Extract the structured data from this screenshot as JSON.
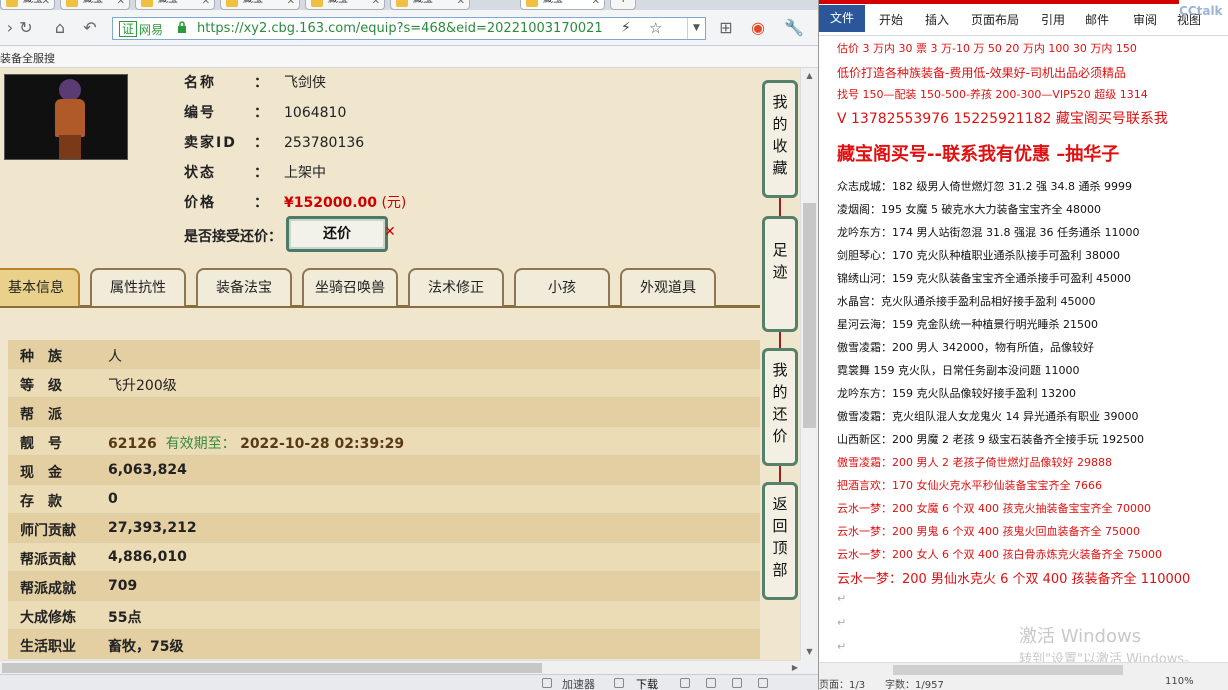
{
  "browser": {
    "tabs": [
      {
        "label": "藏宝"
      },
      {
        "label": "藏宝"
      },
      {
        "label": "藏宝"
      },
      {
        "label": "藏宝"
      },
      {
        "label": "藏宝"
      },
      {
        "label": "藏宝"
      },
      {
        "label": "藏宝"
      }
    ],
    "cert_label": "证",
    "site_label": "网易",
    "url": "https://xy2.cbg.163.com/equip?s=468&eid=20221003170021",
    "favbar_text": "装备全服搜"
  },
  "item_info": {
    "name_label": "名称",
    "name_value": "飞剑侠",
    "number_label": "编号",
    "number_value": "1064810",
    "seller_label": "卖家ID",
    "seller_value": "253780136",
    "status_label": "状态",
    "status_value": "上架中",
    "price_label": "价格",
    "price_value": "¥152000.00",
    "price_unit": "(元)",
    "bargain_label": "是否接受还价：",
    "bargain_button": "还价"
  },
  "tabs": [
    "基本信息",
    "属性抗性",
    "装备法宝",
    "坐骑召唤兽",
    "法术修正",
    "小孩",
    "外观道具"
  ],
  "basic_info": [
    {
      "key": "种族",
      "value": "人"
    },
    {
      "key": "等级",
      "value": "飞升200级"
    },
    {
      "key": "帮派",
      "value": ""
    },
    {
      "key": "靓号",
      "value": "62126",
      "extra_label": "有效期至：",
      "extra_value": "2022-10-28 02:39:29"
    },
    {
      "key": "现金",
      "value": "6,063,824"
    },
    {
      "key": "存款",
      "value": "0"
    },
    {
      "key": "师门贡献",
      "value": "27,393,212"
    },
    {
      "key": "帮派贡献",
      "value": "4,886,010"
    },
    {
      "key": "帮派成就",
      "value": "709"
    },
    {
      "key": "大成修炼",
      "value": "55点"
    },
    {
      "key": "生活职业",
      "value": "畜牧，75级"
    }
  ],
  "side_buttons": [
    {
      "label": "我的收藏"
    },
    {
      "label": "足迹"
    },
    {
      "label": "我的还价"
    },
    {
      "label": "返回顶部"
    }
  ],
  "statusbar": {
    "speed": "加速器",
    "download": "下载"
  },
  "word": {
    "ribbon_tabs": [
      "文件",
      "开始",
      "插入",
      "页面布局",
      "引用",
      "邮件",
      "审阅",
      "视图"
    ],
    "ribbon_overlay": "CCtalk",
    "lines": [
      {
        "text": "估价 3 万内 30 票  3 万-10 万 50 20 万内 100 30 万内 150",
        "style": "red s11"
      },
      {
        "text": "低价打造各种族装备-费用低-效果好-司机出品必须精品",
        "style": "red s12"
      },
      {
        "text": "找号 150—配装 150-500-养孩 200-300—VIP520 超级 1314",
        "style": "red s11"
      },
      {
        "text": "V 13782553976    15225921182  藏宝阁买号联系我",
        "style": "red s14"
      },
      {
        "text": "藏宝阁买号--联系我有优惠 –抽华子",
        "style": "red big"
      },
      {
        "text": "众志成城：182 级男人倚世燃灯忽 31.2 强 34.8 通杀 9999",
        "style": "s11"
      },
      {
        "text": "凌烟阁：195 女魔 5 破克水大力装备宝宝齐全 48000",
        "style": "s11"
      },
      {
        "text": "龙吟东方：174 男人站街忽混 31.8 强混 36 任务通杀 11000",
        "style": "s11"
      },
      {
        "text": "剑胆琴心：170 克火队种植职业通杀队接手可盈利 38000",
        "style": "s11"
      },
      {
        "text": "锦绣山河：159 克火队装备宝宝齐全通杀接手可盈利 45000",
        "style": "s11"
      },
      {
        "text": "水晶宫：克火队通杀接手盈利品相好接手盈利 45000",
        "style": "s11"
      },
      {
        "text": "星河云海：159 克金队统一种植景行明光睡杀 21500",
        "style": "s11"
      },
      {
        "text": "傲雪凌霜：200 男人 342000，物有所值，品像较好",
        "style": "s11"
      },
      {
        "text": "霓裳舞 159 克火队，日常任务副本没问题 11000",
        "style": "s11"
      },
      {
        "text": "龙吟东方：159 克火队品像较好接手盈利 13200",
        "style": "s11"
      },
      {
        "text": "傲雪凌霜：克火组队混人女龙鬼火 14 异光通杀有职业 39000",
        "style": "s11"
      },
      {
        "text": "山西新区：200 男魔 2 老孩 9 级宝石装备齐全接手玩 192500",
        "style": "s11"
      },
      {
        "text": "傲雪凌霜：200 男人 2 老孩子倚世燃灯品像较好 29888",
        "style": "red s11"
      },
      {
        "text": "把酒言欢：170 女仙火克水平秒仙装备宝宝齐全 7666",
        "style": "red s11"
      },
      {
        "text": "云水一梦：200 女魔 6 个双 400 孩克火抽装备宝宝齐全 70000",
        "style": "red s11"
      },
      {
        "text": "云水一梦：200 男鬼 6 个双 400 孩鬼火回血装备齐全 75000",
        "style": "red s11"
      },
      {
        "text": "云水一梦：200 女人 6 个双 400 孩白骨赤炼克火装备齐全 75000",
        "style": "red s11"
      },
      {
        "text": "云水一梦：200 男仙水克火 6 个双 400 孩装备齐全 110000",
        "style": "red s13"
      }
    ],
    "watermark_title": "激活 Windows",
    "watermark_sub": "转到\"设置\"以激活 Windows。",
    "status_page": "页面：1/3",
    "status_words": "字数：1/957",
    "status_zoom": "110%"
  }
}
